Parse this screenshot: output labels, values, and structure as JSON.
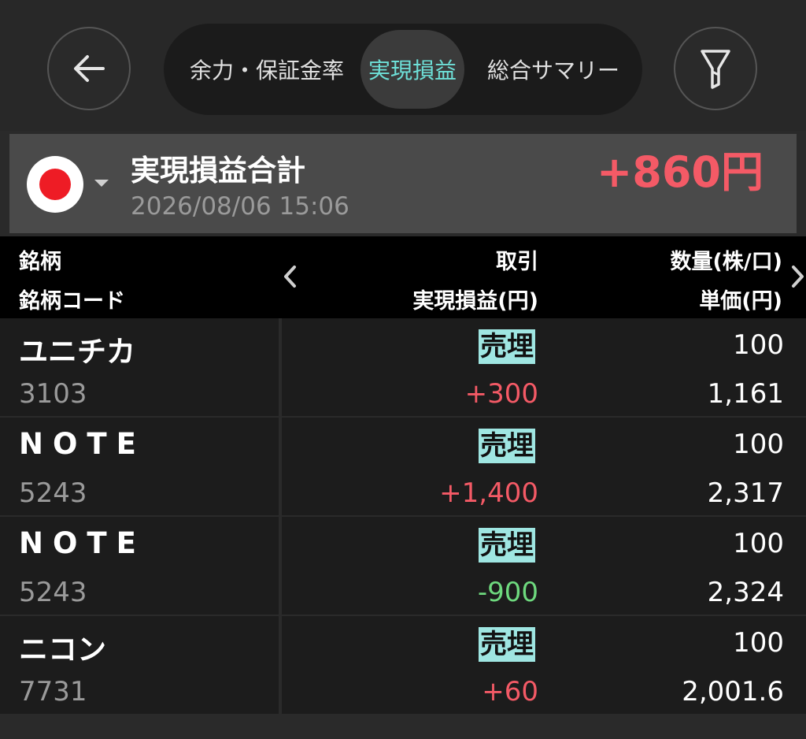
{
  "tabs": [
    "余力・保証金率",
    "実現損益",
    "総合サマリー"
  ],
  "active_tab": "実現損益",
  "icons": {
    "back": "arrow-left-icon",
    "filter": "filter-icon",
    "flag": "japan-flag-icon",
    "caret": "caret-down-icon",
    "left": "chevron-left-icon",
    "right": "chevron-right-icon"
  },
  "summary": {
    "title": "実現損益合計",
    "timestamp": "2026/08/06 15:06",
    "total": "+860円"
  },
  "columns": {
    "col1_line1": "銘柄",
    "col1_line2": "銘柄コード",
    "col2_line1": "取引",
    "col2_line2": "実現損益(円)",
    "col3_line1": "数量(株/口)",
    "col3_line2": "単価(円)"
  },
  "rows": [
    {
      "name": "ユニチカ",
      "code": "3103",
      "trade": "売埋",
      "pnl": "+300",
      "qty": "100",
      "price": "1,161"
    },
    {
      "name": "NOTE",
      "code": "5243",
      "trade": "売埋",
      "pnl": "+1,400",
      "qty": "100",
      "price": "2,317"
    },
    {
      "name": "NOTE",
      "code": "5243",
      "trade": "売埋",
      "pnl": "-900",
      "qty": "100",
      "price": "2,324"
    },
    {
      "name": "ニコン",
      "code": "7731",
      "trade": "売埋",
      "pnl": "+60",
      "qty": "100",
      "price": "2,001.6"
    }
  ],
  "colors": {
    "positive": "#f45a66",
    "negative": "#6ed97e",
    "accent": "#6ee0d8",
    "trade_badge": "#9fe6e2"
  }
}
